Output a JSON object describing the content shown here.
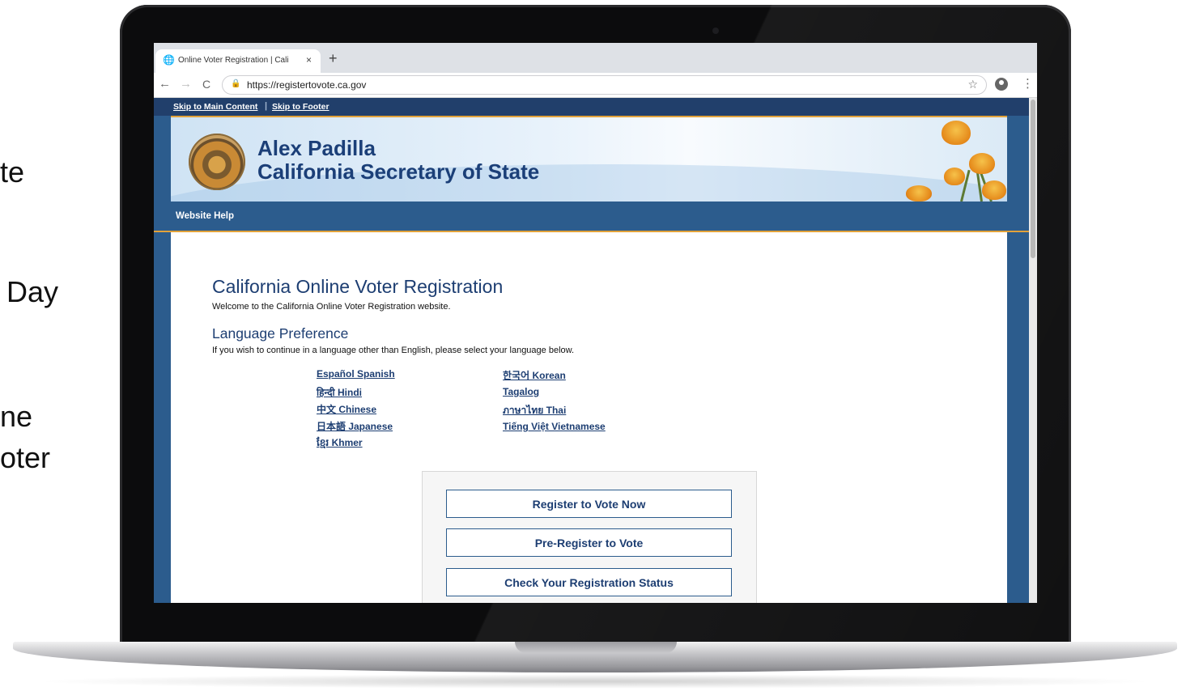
{
  "side_text": [
    "te",
    "Day",
    "ne",
    "oter"
  ],
  "browser": {
    "tab_title": "Online Voter Registration | Cali",
    "tab_close": "×",
    "new_tab": "+",
    "url": "https://registertovote.ca.gov",
    "back": "←",
    "forward": "→",
    "reload": "C",
    "star": "☆",
    "menu": "⋮"
  },
  "skip": {
    "main": "Skip to Main Content",
    "separator": "|",
    "footer": "Skip to Footer"
  },
  "banner": {
    "name": "Alex Padilla",
    "title": "California Secretary of State"
  },
  "nav": {
    "help": "Website Help"
  },
  "main": {
    "heading": "California Online Voter Registration",
    "welcome": "Welcome to the California Online Voter Registration website.",
    "lang_heading": "Language Preference",
    "lang_note": "If you wish to continue in a language other than English, please select your language below."
  },
  "languages_left": [
    "Español Spanish",
    "हिन्दी Hindi",
    "中文 Chinese",
    "日本語 Japanese",
    "ខ្មែរ Khmer"
  ],
  "languages_right": [
    "한국어 Korean",
    "Tagalog",
    "ภาษาไทย Thai",
    "Tiếng Việt Vietnamese"
  ],
  "actions": [
    "Register to Vote Now",
    "Pre-Register to Vote",
    "Check Your Registration Status"
  ],
  "colors": {
    "navy": "#1d3e72",
    "nav_blue": "#2c5c8d",
    "gold_rule": "#e2a23a"
  }
}
